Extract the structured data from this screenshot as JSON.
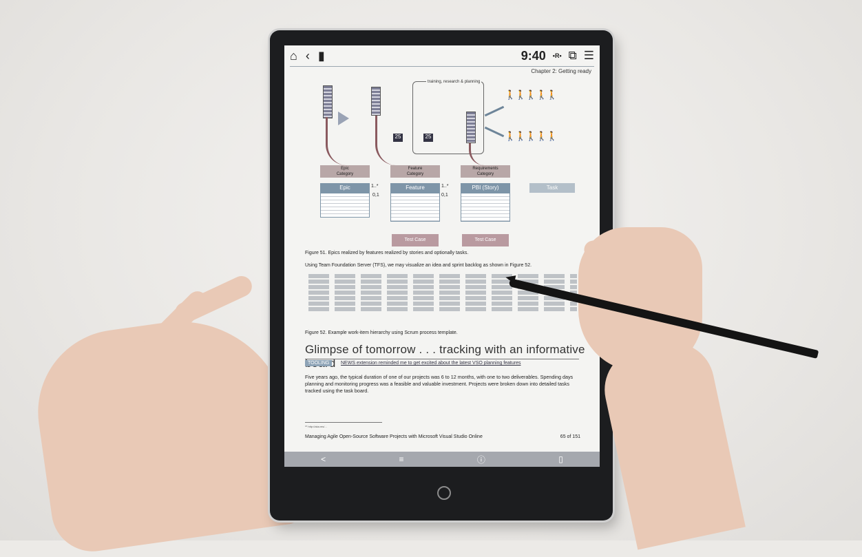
{
  "status_bar": {
    "time": "9:40",
    "radio_indicator": "•R•",
    "icons": [
      "home-icon",
      "back-icon",
      "trash-icon",
      "split-view-icon",
      "menu-icon"
    ]
  },
  "chapter_header": "Chapter 2: Getting ready",
  "diagram": {
    "top_label": "training, research & planning",
    "categories": [
      {
        "title": "Epic",
        "subtitle": "Category"
      },
      {
        "title": "Feature",
        "subtitle": "Category"
      },
      {
        "title": "Requirements",
        "subtitle": "Category"
      }
    ],
    "entities": [
      "Epic",
      "Feature",
      "PBI (Story)",
      "Task"
    ],
    "relations": [
      "1..*",
      "0,1",
      "1..*",
      "0,1"
    ],
    "test_cases": [
      "Test Case",
      "Test Case"
    ]
  },
  "figure51_caption": "Figure 51.  Epics realized by features realized by stories and optionally tasks.",
  "tfs_sentence": "Using Team Foundation Server (TFS), we may visualize an idea and sprint backlog as shown in Figure 52.",
  "figure52_caption": "Figure 52.  Example work-item hierarchy using Scrum process template.",
  "section_heading": "Glimpse of tomorrow . . . tracking with an informative board",
  "tag_label": "TOOLING",
  "news_link": "NEWS extension reminded me to get excited about the latest VSO planning features",
  "paragraph": "Five years ago, the typical duration of one of our projects was 6 to 12 months, with one to two deliverables. Spending days planning and monitoring progress was a feasible and valuable investment. Projects were broken down into detailed tasks tracked using the task board.",
  "footnote": "⁶⁰ http://aka.ms/...",
  "footer_title": "Managing Agile Open-Source Software Projects with Microsoft Visual Studio Online",
  "page_number": "65 of 151",
  "bottom_bar_icons": [
    "share-icon",
    "settings-icon",
    "info-icon",
    "delete-icon"
  ],
  "colors": {
    "device": "#1c1d1f",
    "screen": "#f4f4f2",
    "accent": "#7e95a8",
    "skin": "#e9c9b6"
  }
}
